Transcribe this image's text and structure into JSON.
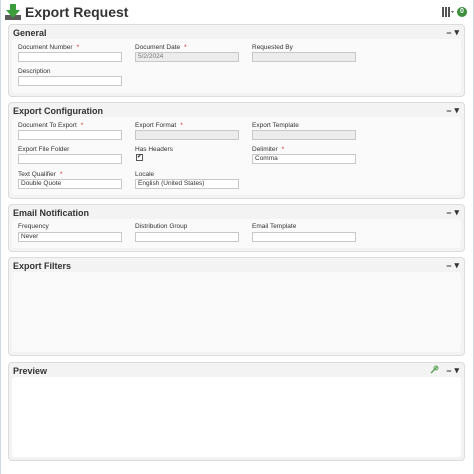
{
  "window": {
    "title": "Export Request",
    "badge_value": "0"
  },
  "colors": {
    "accent_green": "#3c8d3c",
    "required_marker": "#d9261c",
    "section_bg": "#f3f3f3"
  },
  "icons": {
    "app": "export-arrow-icon",
    "columns": "columns-icon",
    "badge": "info-badge-icon",
    "collapse": "minus-icon",
    "menu": "dropdown-arrow-icon",
    "pin": "pin-icon"
  },
  "sections": {
    "general": {
      "title": "General",
      "collapse_glyph": "−",
      "menu_glyph": "▾",
      "document_number": {
        "label": "Document Number",
        "value": ""
      },
      "document_date": {
        "label": "Document Date",
        "value": "5/2/2024"
      },
      "requested_by": {
        "label": "Requested By",
        "value": ""
      },
      "description": {
        "label": "Description",
        "value": ""
      }
    },
    "export_configuration": {
      "title": "Export Configuration",
      "collapse_glyph": "−",
      "menu_glyph": "▾",
      "document_to_export": {
        "label": "Document To Export",
        "value": ""
      },
      "export_format": {
        "label": "Export Format",
        "value": ""
      },
      "export_template": {
        "label": "Export Template",
        "value": ""
      },
      "export_file_folder": {
        "label": "Export File Folder",
        "value": ""
      },
      "has_headers": {
        "label": "Has Headers",
        "checked": true,
        "check_glyph": "✔"
      },
      "delimiter": {
        "label": "Delimiter",
        "value": "Comma"
      },
      "text_qualifier": {
        "label": "Text Qualifier",
        "value": "Double Quote"
      },
      "locale": {
        "label": "Locale",
        "value": "English (United States)"
      }
    },
    "email_notification": {
      "title": "Email Notification",
      "collapse_glyph": "−",
      "menu_glyph": "▾",
      "frequency": {
        "label": "Frequency",
        "value": "Never"
      },
      "distribution_group": {
        "label": "Distribution Group",
        "value": ""
      },
      "email_template": {
        "label": "Email Template",
        "value": ""
      }
    },
    "export_filters": {
      "title": "Export Filters",
      "collapse_glyph": "−",
      "menu_glyph": "▾"
    },
    "preview": {
      "title": "Preview",
      "collapse_glyph": "−",
      "menu_glyph": "▾"
    }
  },
  "required_marker": "*"
}
